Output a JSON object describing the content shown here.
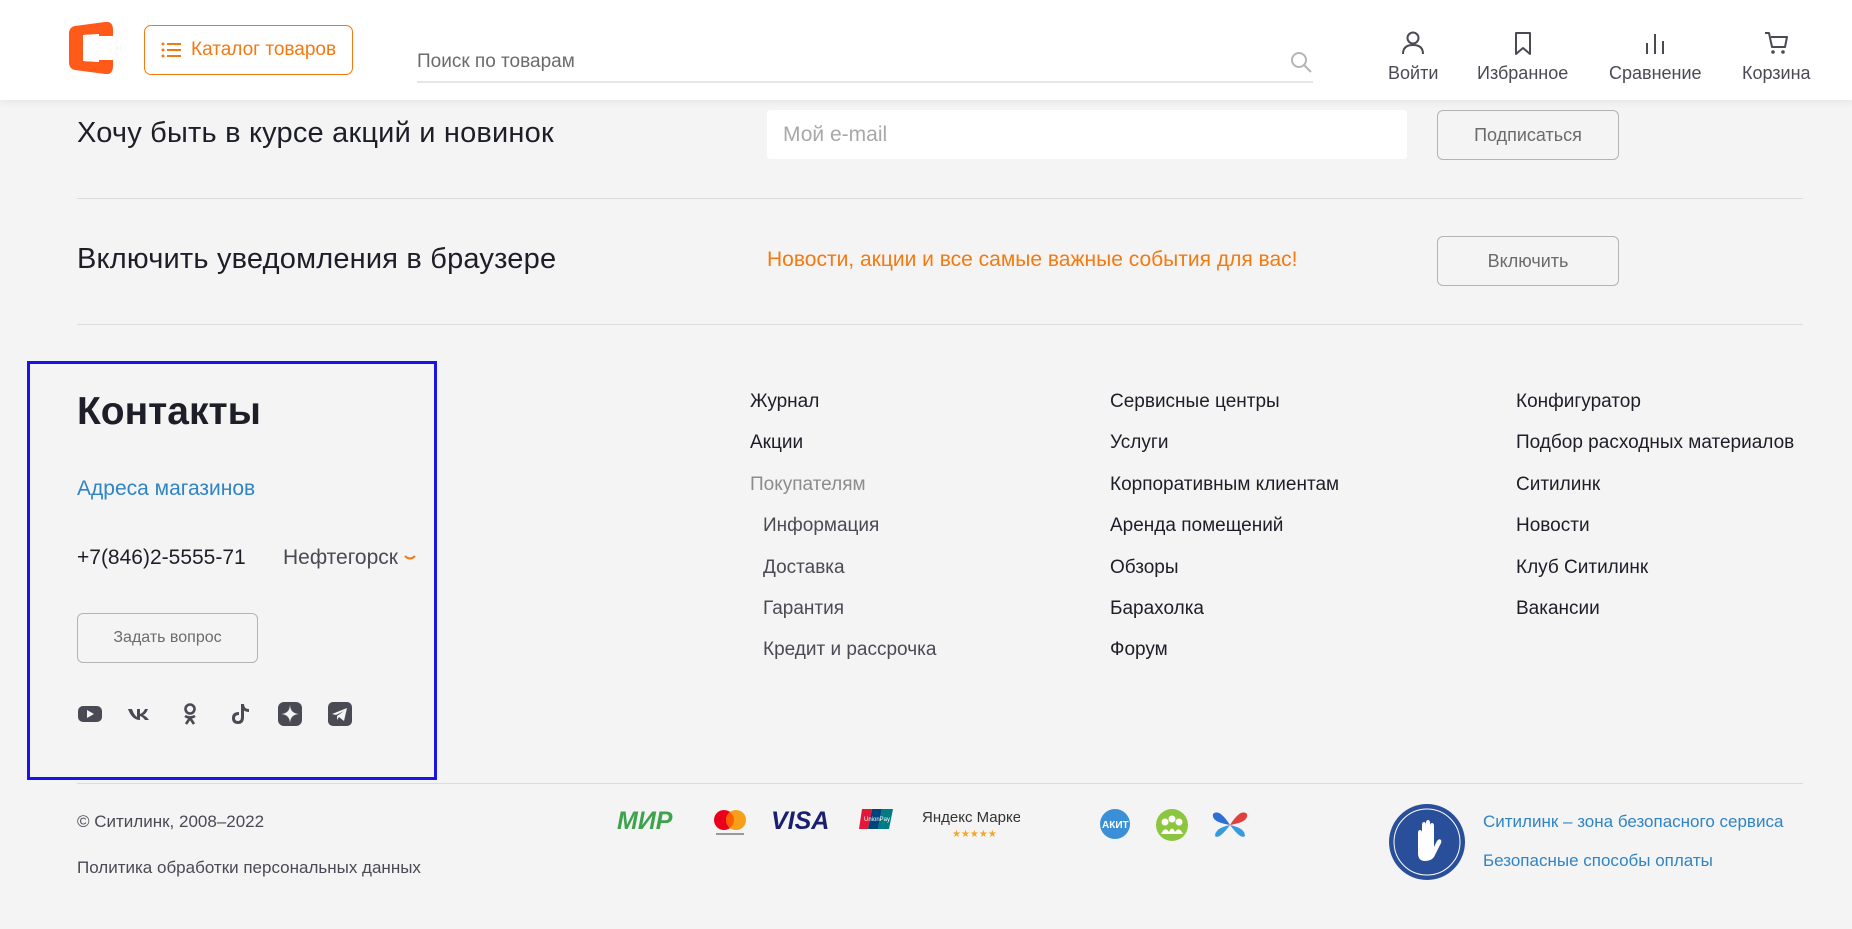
{
  "header": {
    "catalog_label": "Каталог товаров",
    "search_placeholder": "Поиск по товарам",
    "nav": [
      {
        "label": "Войти",
        "icon": "user-icon"
      },
      {
        "label": "Избранное",
        "icon": "bookmark-icon"
      },
      {
        "label": "Сравнение",
        "icon": "compare-icon"
      },
      {
        "label": "Корзина",
        "icon": "cart-icon"
      }
    ]
  },
  "subscribe": {
    "title": "Хочу быть в курсе акций и новинок",
    "email_placeholder": "Мой e-mail",
    "button": "Подписаться"
  },
  "notifications": {
    "title": "Включить уведомления в браузере",
    "text": "Новости, акции и все самые важные события для вас!",
    "button": "Включить"
  },
  "contacts": {
    "title": "Контакты",
    "address_link": "Адреса магазинов",
    "phone": "+7(846)2-5555-71",
    "city": "Нефтегорск",
    "ask_button": "Задать вопрос",
    "social": [
      "youtube-icon",
      "vk-icon",
      "ok-icon",
      "tiktok-icon",
      "zen-icon",
      "telegram-icon"
    ]
  },
  "columns": {
    "col1": [
      "Журнал",
      "Акции",
      "Покупателям",
      "Информация",
      "Доставка",
      "Гарантия",
      "Кредит и рассрочка"
    ],
    "col2": [
      "Сервисные центры",
      "Услуги",
      "Корпоративным клиентам",
      "Аренда помещений",
      "Обзоры",
      "Барахолка",
      "Форум"
    ],
    "col3": [
      "Конфигуратор",
      "Подбор расходных материалов",
      "Ситилинк",
      "Новости",
      "Клуб Ситилинк",
      "Вакансии"
    ]
  },
  "footer": {
    "copyright": "© Ситилинк, 2008–2022",
    "policy": "Политика обработки персональных данных",
    "payments": {
      "mir": "МИР",
      "visa": "VISA",
      "unionpay": "UnionPay",
      "yandex_market": "Яндекс Маркет"
    },
    "safe_zone_link": "Ситилинк – зона безопасного сервиса",
    "safe_payment_link": "Безопасные способы оплаты"
  },
  "colors": {
    "accent": "#f37a10",
    "link": "#2f84c6",
    "highlight_border": "#1a14e6"
  }
}
